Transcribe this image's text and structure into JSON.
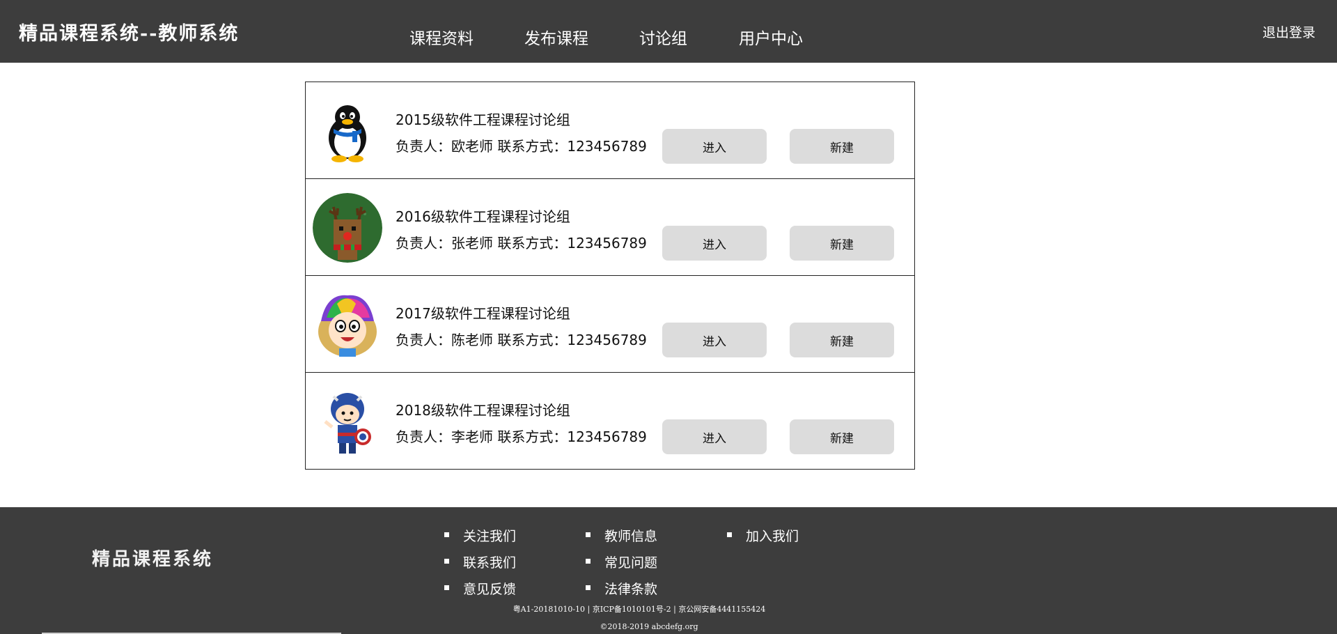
{
  "header": {
    "brand": "精品课程系统--教师系统",
    "nav": [
      {
        "label": "课程资料"
      },
      {
        "label": "发布课程"
      },
      {
        "label": "讨论组"
      },
      {
        "label": "用户中心"
      }
    ],
    "logout": "退出登录"
  },
  "groups": [
    {
      "name": "2015级软件工程课程讨论组",
      "info": "负责人：欧老师 联系方式：123456789",
      "enter": "进入",
      "create": "新建",
      "avatar_icon": "qq-penguin-avatar"
    },
    {
      "name": "2016级软件工程课程讨论组",
      "info": "负责人：张老师 联系方式：123456789",
      "enter": "进入",
      "create": "新建",
      "avatar_icon": "reindeer-avatar"
    },
    {
      "name": "2017级软件工程课程讨论组",
      "info": "负责人：陈老师 联系方式：123456789",
      "enter": "进入",
      "create": "新建",
      "avatar_icon": "rainbow-hair-avatar"
    },
    {
      "name": "2018级软件工程课程讨论组",
      "info": "负责人：李老师 联系方式：123456789",
      "enter": "进入",
      "create": "新建",
      "avatar_icon": "captain-avatar"
    }
  ],
  "footer": {
    "brand": "精品课程系统",
    "links": [
      {
        "label": "关注我们"
      },
      {
        "label": "教师信息"
      },
      {
        "label": "加入我们"
      },
      {
        "label": "联系我们"
      },
      {
        "label": "常见问题"
      },
      {
        "label": "意见反馈"
      },
      {
        "label": "法律条款"
      }
    ],
    "icp": "粤A1-20181010-10 | 京ICP备1010101号-2 | 京公网安备4441155424",
    "copyright": "©2018-2019 abcdefg.org"
  },
  "colors": {
    "bar_bg": "#3d3d3d",
    "button_bg": "#dcdcdc",
    "card_border": "#222222"
  }
}
